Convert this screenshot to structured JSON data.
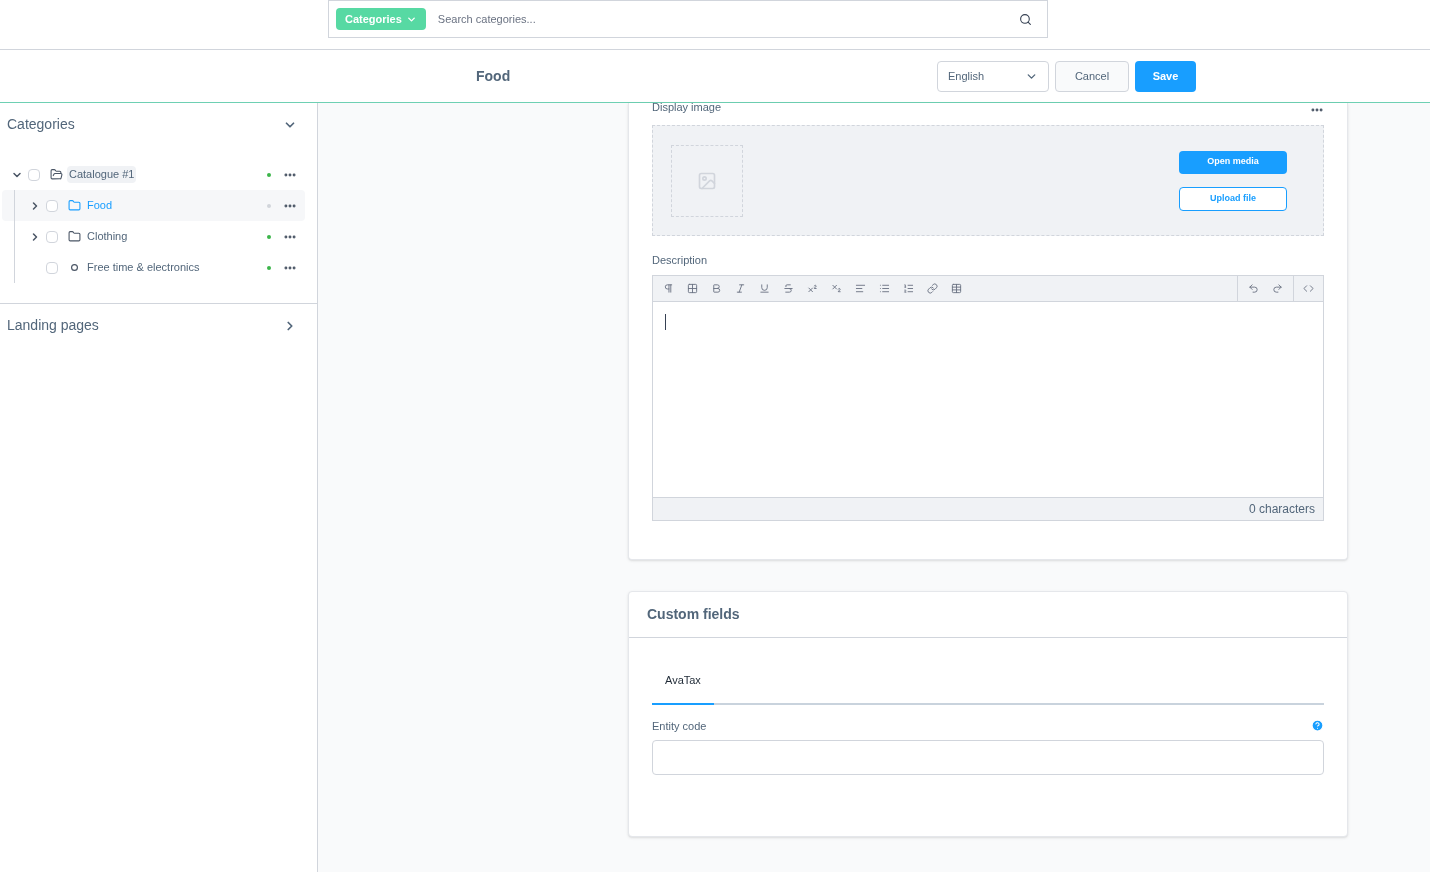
{
  "search": {
    "scope": "Categories",
    "placeholder": "Search categories..."
  },
  "header": {
    "title": "Food",
    "language": "English",
    "cancel": "Cancel",
    "save": "Save"
  },
  "sidebar": {
    "sections": [
      {
        "title": "Categories",
        "expanded": true,
        "tree": [
          {
            "label": "Catalogue #1",
            "kind": "folder",
            "expanded": true,
            "selected": false,
            "checked": false,
            "color": "#3cb54a",
            "children": [
              {
                "label": "Food",
                "kind": "folder",
                "expanded": false,
                "selected": true,
                "checked": false,
                "color": "#d1d5db"
              },
              {
                "label": "Clothing",
                "kind": "folder",
                "expanded": false,
                "selected": false,
                "checked": false,
                "color": "#3cb54a"
              },
              {
                "label": "Free time & electronics",
                "kind": "leaf",
                "selected": false,
                "checked": false,
                "color": "#3cb54a"
              }
            ]
          }
        ]
      },
      {
        "title": "Landing pages",
        "expanded": false
      }
    ]
  },
  "media": {
    "label": "Display image",
    "open": "Open media",
    "upload": "Upload file"
  },
  "description": {
    "label": "Description",
    "counter": "0 characters"
  },
  "custom_fields": {
    "title": "Custom fields",
    "tabs": [
      {
        "label": "AvaTax",
        "selected": true
      }
    ],
    "field": {
      "label": "Entity code"
    }
  }
}
